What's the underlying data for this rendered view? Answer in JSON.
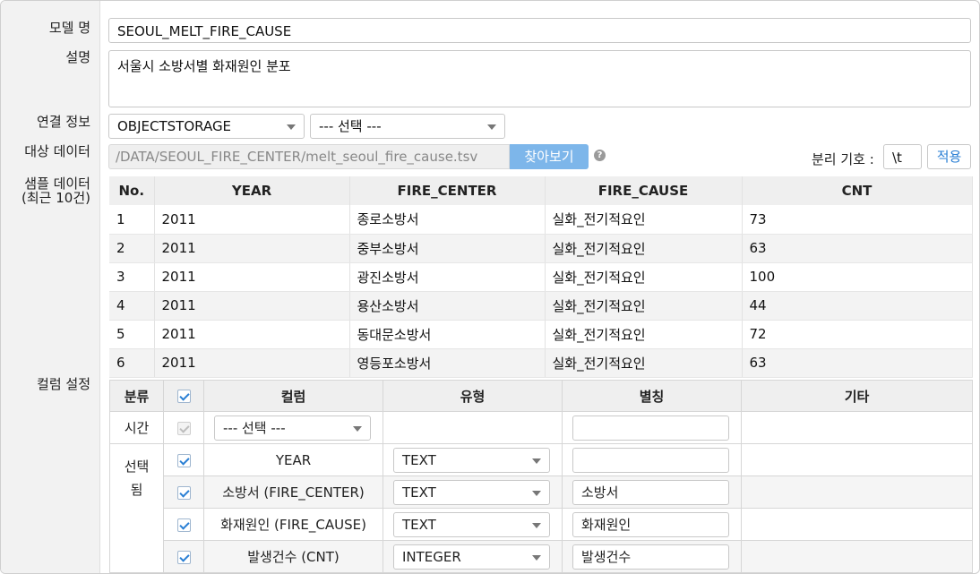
{
  "labels": {
    "model_name": "모델 명",
    "description": "설명",
    "connection": "연결 정보",
    "target_data": "대상 데이터",
    "sample_line1": "샘플 데이터",
    "sample_line2": "(최근 10건)",
    "column_settings": "컬럼 설정",
    "separator": "분리 기호 :"
  },
  "model_name": "SEOUL_MELT_FIRE_CAUSE",
  "description": "서울시 소방서별 화재원인 분포",
  "connection": {
    "storage": "OBJECTSTORAGE",
    "secondary": "--- 선택 ---"
  },
  "target": {
    "path": "/DATA/SEOUL_FIRE_CENTER/melt_seoul_fire_cause.tsv",
    "browse_label": "찾아보기",
    "help_glyph": "?",
    "separator_value": "\\t",
    "apply_label": "적용"
  },
  "sample": {
    "headers": [
      "No.",
      "YEAR",
      "FIRE_CENTER",
      "FIRE_CAUSE",
      "CNT"
    ],
    "rows": [
      [
        "1",
        "2011",
        "종로소방서",
        "실화_전기적요인",
        "73"
      ],
      [
        "2",
        "2011",
        "중부소방서",
        "실화_전기적요인",
        "63"
      ],
      [
        "3",
        "2011",
        "광진소방서",
        "실화_전기적요인",
        "100"
      ],
      [
        "4",
        "2011",
        "용산소방서",
        "실화_전기적요인",
        "44"
      ],
      [
        "5",
        "2011",
        "동대문소방서",
        "실화_전기적요인",
        "72"
      ],
      [
        "6",
        "2011",
        "영등포소방서",
        "실화_전기적요인",
        "63"
      ]
    ]
  },
  "columns": {
    "headers": [
      "분류",
      "",
      "컬럼",
      "유형",
      "별칭",
      "기타"
    ],
    "time_group": "시간",
    "selected_group_line1": "선택",
    "selected_group_line2": "됨",
    "time_select": "--- 선택 ---",
    "rows": [
      {
        "column": "YEAR",
        "type": "TEXT",
        "alias": ""
      },
      {
        "column": "소방서 (FIRE_CENTER)",
        "type": "TEXT",
        "alias": "소방서"
      },
      {
        "column": "화재원인 (FIRE_CAUSE)",
        "type": "TEXT",
        "alias": "화재원인"
      },
      {
        "column": "발생건수 (CNT)",
        "type": "INTEGER",
        "alias": "발생건수"
      }
    ]
  },
  "colors": {
    "accent": "#2a7fd4",
    "browse_button": "#7db6ea",
    "label_background": "#f2f2f2"
  }
}
